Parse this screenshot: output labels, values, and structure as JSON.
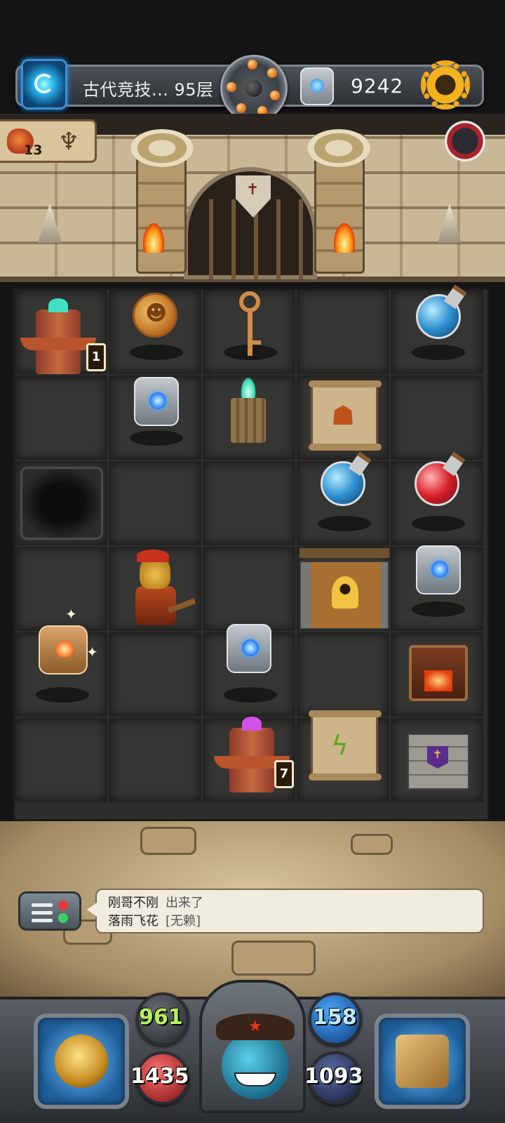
{
  "header": {
    "floor_label": "古代竞技... 95层",
    "currency_value": "9242"
  },
  "quest": {
    "count": "13"
  },
  "board": {
    "hourglass_top": "1",
    "hourglass_bottom": "7"
  },
  "chat": {
    "messages": [
      {
        "name": "刚哥不刚",
        "text": "出来了"
      },
      {
        "name": "落雨飞花",
        "text": "[无赖]"
      }
    ]
  },
  "stats": {
    "attack": "961",
    "defense": "158",
    "hp": "1435",
    "mp": "1093"
  },
  "colors": {
    "attack": "#b8f05a",
    "defense": "#bfe8ff",
    "currency_gold": "#f5b21e",
    "potion_blue": "#2e8fd0",
    "potion_red": "#d8202a"
  }
}
